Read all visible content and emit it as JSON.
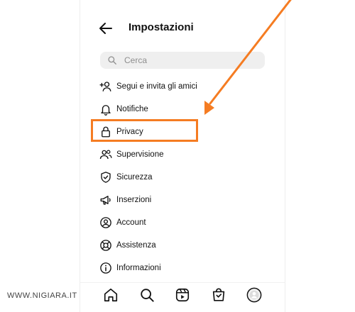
{
  "header": {
    "title": "Impostazioni"
  },
  "search": {
    "placeholder": "Cerca",
    "value": ""
  },
  "menu": {
    "items": [
      {
        "label": "Segui e invita gli amici",
        "icon": "add-person-icon"
      },
      {
        "label": "Notifiche",
        "icon": "bell-icon"
      },
      {
        "label": "Privacy",
        "icon": "lock-icon"
      },
      {
        "label": "Supervisione",
        "icon": "people-icon"
      },
      {
        "label": "Sicurezza",
        "icon": "shield-icon"
      },
      {
        "label": "Inserzioni",
        "icon": "megaphone-icon"
      },
      {
        "label": "Account",
        "icon": "account-circle-icon"
      },
      {
        "label": "Assistenza",
        "icon": "lifebuoy-icon"
      },
      {
        "label": "Informazioni",
        "icon": "info-icon"
      }
    ]
  },
  "bottom_nav": {
    "items": [
      {
        "icon": "home-icon"
      },
      {
        "icon": "search-icon"
      },
      {
        "icon": "reels-icon"
      },
      {
        "icon": "shop-icon"
      },
      {
        "icon": "profile-avatar-icon"
      }
    ]
  },
  "annotation": {
    "highlight_color": "#f57c22"
  },
  "watermark": {
    "text": "WWW.NIGIARA.IT"
  }
}
